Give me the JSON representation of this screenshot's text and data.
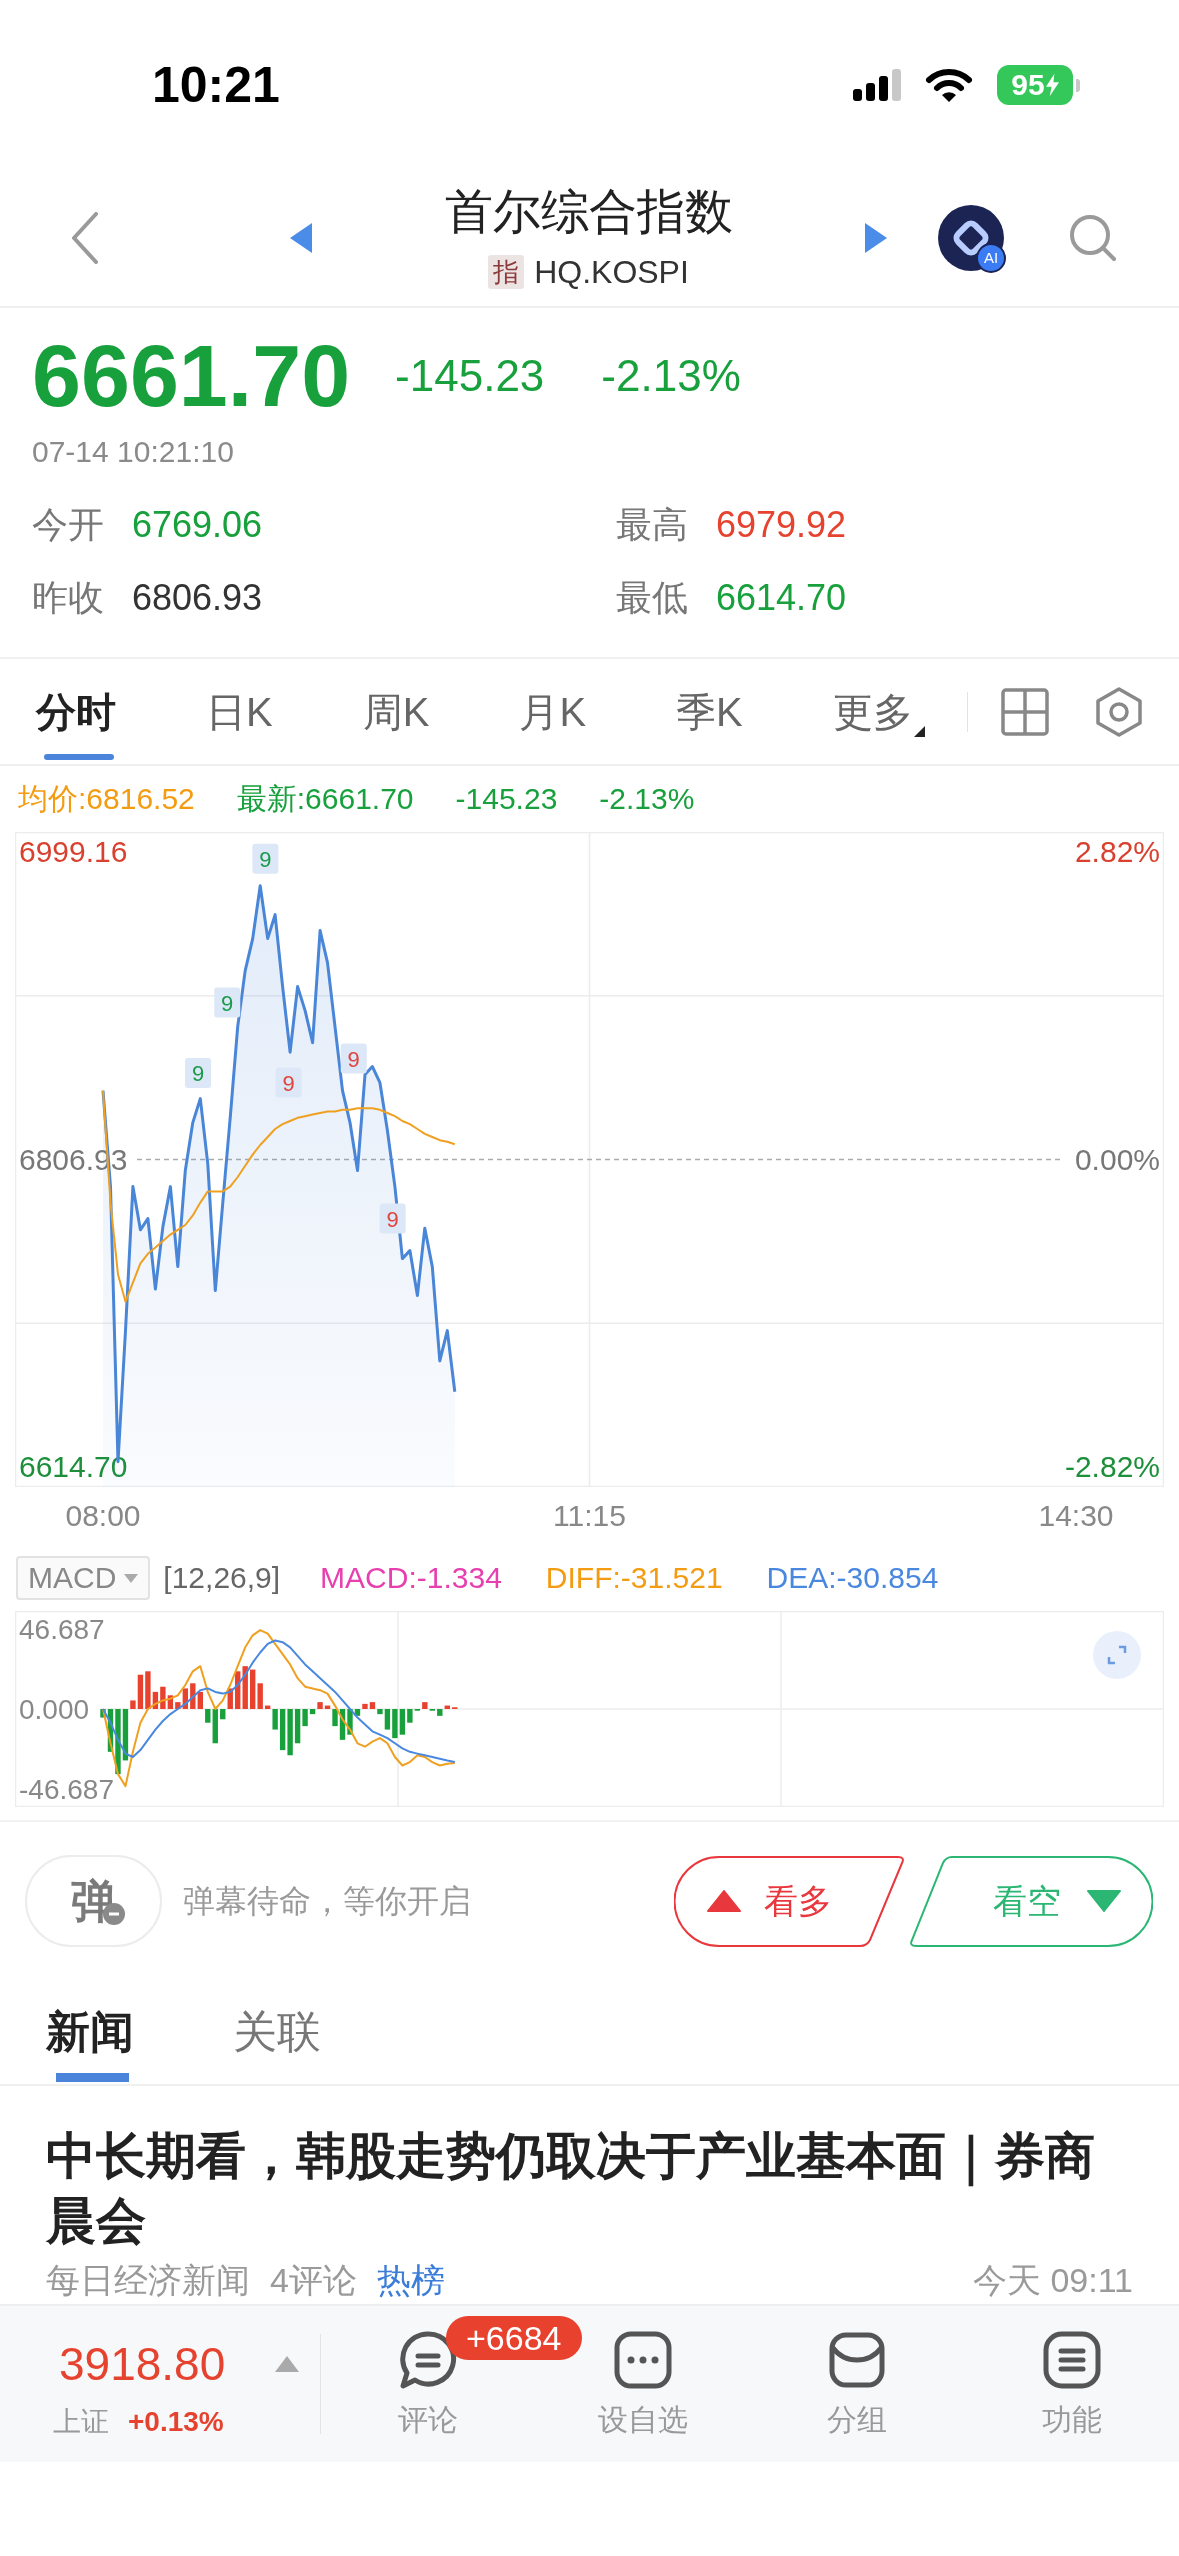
{
  "status_bar": {
    "time": "10:21",
    "battery": "95"
  },
  "header": {
    "title": "首尔综合指数",
    "type_badge": "指",
    "code": "HQ.KOSPI",
    "ai_badge": "AI"
  },
  "quote": {
    "price": "6661.70",
    "change": "-145.23",
    "change_pct": "-2.13%",
    "rising": false,
    "timestamp": "07-14 10:21:10",
    "stats": [
      {
        "label": "今开",
        "value": "6769.06",
        "color": "#17a03c"
      },
      {
        "label": "最高",
        "value": "6979.92",
        "color": "#e5432f"
      },
      {
        "label": "昨收",
        "value": "6806.93",
        "color": "#333333"
      },
      {
        "label": "最低",
        "value": "6614.70",
        "color": "#17a03c"
      }
    ]
  },
  "chart_tabs": [
    {
      "label": "分时",
      "selected": true,
      "dropdown": false
    },
    {
      "label": "日K",
      "selected": false,
      "dropdown": false
    },
    {
      "label": "周K",
      "selected": false,
      "dropdown": false
    },
    {
      "label": "月K",
      "selected": false,
      "dropdown": false
    },
    {
      "label": "季K",
      "selected": false,
      "dropdown": false
    },
    {
      "label": "更多",
      "selected": false,
      "dropdown": true
    }
  ],
  "price_chart": {
    "legend": [
      {
        "text": "均价:6816.52",
        "color": "#f39c12"
      },
      {
        "text": "最新:6661.70",
        "color": "#17a03c"
      },
      {
        "text": "-145.23",
        "color": "#17a03c"
      },
      {
        "text": "-2.13%",
        "color": "#17a03c"
      }
    ],
    "percent_labels": [
      "2.82%",
      "0.00%",
      "-2.82%"
    ],
    "signals": [
      {
        "text": "9",
        "color": "#1a9a4a"
      },
      {
        "text": "9",
        "color": "#1a9a4a"
      },
      {
        "text": "9",
        "color": "#1a9a4a"
      },
      {
        "text": "9",
        "color": "#e0443a"
      },
      {
        "text": "9",
        "color": "#e0443a"
      },
      {
        "text": "9",
        "color": "#e0443a"
      }
    ],
    "chart_data": {
      "type": "line",
      "categories": [
        "08:00",
        null,
        null,
        null,
        null,
        null,
        null,
        null,
        null,
        null,
        null,
        null,
        null,
        null,
        null,
        null,
        null,
        null,
        null,
        null,
        null,
        null,
        null,
        null,
        null,
        null,
        null,
        null,
        null,
        null,
        null,
        null,
        null,
        null,
        null,
        null,
        null,
        null,
        null,
        null,
        null,
        null,
        null,
        null,
        null,
        null,
        null,
        null,
        null,
        null,
        null,
        null,
        null,
        null,
        null,
        null,
        null,
        null,
        null,
        null,
        null,
        null,
        null,
        null,
        null,
        "11:15",
        null,
        null,
        null,
        null,
        null,
        null,
        null,
        null,
        null,
        null,
        null,
        null,
        null,
        null,
        null,
        null,
        null,
        null,
        null,
        null,
        null,
        null,
        null,
        null,
        null,
        null,
        null,
        null,
        null,
        null,
        null,
        null,
        null,
        null,
        null,
        null,
        null,
        null,
        null,
        null,
        null,
        null,
        null,
        null,
        null,
        null,
        null,
        null,
        null,
        null,
        null,
        null,
        null,
        null,
        null,
        null,
        null,
        null,
        null,
        null,
        null,
        null,
        null,
        null,
        "14:30"
      ],
      "ylim": [
        6614.7,
        6999.16
      ],
      "yticks": [
        {
          "value": 6999.16,
          "label": "6999.16"
        },
        {
          "value": 6806.93,
          "label": "6806.93"
        },
        {
          "value": 6614.7,
          "label": "6614.70"
        }
      ],
      "ref_lines": [
        {
          "axis": "y",
          "value": 6806.93
        }
      ],
      "series": [
        {
          "color": "#4a86d8",
          "values": [
            6850,
            6790,
            6618,
            6700,
            6790,
            6763,
            6770,
            6726,
            6765,
            6790,
            6740,
            6800,
            6830,
            6845,
            6804,
            6725,
            6780,
            6833,
            6890,
            6925,
            6945,
            6978,
            6945,
            6960,
            6915,
            6874,
            6915,
            6900,
            6880,
            6950,
            6930,
            6890,
            6850,
            6830,
            6800,
            6860,
            6865,
            6855,
            6825,
            6790,
            6745,
            6750,
            6722,
            6764,
            6740,
            6681,
            6700,
            6661.7,
            null,
            null,
            null,
            null,
            null,
            null,
            null,
            null,
            null,
            null,
            null,
            null,
            null,
            null,
            null,
            null,
            null,
            null,
            null,
            null,
            null,
            null,
            null,
            null,
            null,
            null,
            null,
            null,
            null,
            null,
            null,
            null,
            null,
            null,
            null,
            null,
            null,
            null,
            null,
            null,
            null,
            null,
            null,
            null,
            null,
            null,
            null,
            null,
            null,
            null,
            null,
            null,
            null,
            null,
            null,
            null,
            null,
            null,
            null,
            null,
            null,
            null,
            null,
            null,
            null,
            null,
            null,
            null,
            null,
            null,
            null,
            null,
            null,
            null,
            null,
            null,
            null,
            null,
            null,
            null,
            null,
            null,
            null
          ]
        },
        {
          "color": "#f0a020",
          "values": [
            6850,
            6780,
            6735,
            6718,
            6730,
            6742,
            6748,
            6752,
            6756,
            6760,
            6763,
            6766,
            6772,
            6780,
            6787,
            6787,
            6787,
            6790,
            6796,
            6803,
            6810,
            6816,
            6821,
            6826,
            6829,
            6831,
            6833,
            6834,
            6835,
            6836,
            6837,
            6837,
            6838,
            6838,
            6839,
            6839,
            6839,
            6838,
            6836,
            6834,
            6831,
            6829,
            6826,
            6823,
            6821,
            6819,
            6818,
            6816.5,
            null,
            null,
            null,
            null,
            null,
            null,
            null,
            null,
            null,
            null,
            null,
            null,
            null,
            null,
            null,
            null,
            null,
            null,
            null,
            null,
            null,
            null,
            null,
            null,
            null,
            null,
            null,
            null,
            null,
            null,
            null,
            null,
            null,
            null,
            null,
            null,
            null,
            null,
            null,
            null,
            null,
            null,
            null,
            null,
            null,
            null,
            null,
            null,
            null,
            null,
            null,
            null,
            null,
            null,
            null,
            null,
            null,
            null,
            null,
            null,
            null,
            null,
            null,
            null,
            null,
            null,
            null,
            null,
            null,
            null,
            null,
            null,
            null,
            null,
            null,
            null,
            null,
            null,
            null,
            null,
            null,
            null,
            null
          ]
        }
      ]
    }
  },
  "macd": {
    "indicator": "MACD",
    "params": "[12,26,9]",
    "values": [
      {
        "text": "MACD:-1.334",
        "color": "#e83fb0"
      },
      {
        "text": "DIFF:-31.521",
        "color": "#f39c12"
      },
      {
        "text": "DEA:-30.854",
        "color": "#4a88e0"
      }
    ],
    "chart_data": {
      "type": "bar",
      "categories": [
        null,
        null,
        null,
        null,
        null,
        null,
        null,
        null,
        null,
        null,
        null,
        null,
        null,
        null,
        null,
        null,
        null,
        null,
        null,
        null,
        null,
        null,
        null,
        null,
        null,
        null,
        null,
        null,
        null,
        null,
        null,
        null,
        null,
        null,
        null,
        null,
        null,
        null,
        null,
        null,
        null,
        null,
        null,
        null,
        null,
        null,
        null,
        null,
        null,
        null,
        null,
        null,
        null,
        null,
        null,
        null,
        null,
        null,
        null,
        null,
        null,
        null,
        null,
        null,
        null,
        null,
        null,
        null,
        null,
        null,
        null,
        null,
        null,
        null,
        null,
        null,
        null,
        null,
        null,
        null,
        null,
        null,
        null,
        null,
        null,
        null,
        null,
        null,
        null,
        null,
        null,
        null,
        null,
        null,
        null,
        null,
        null,
        null,
        null,
        null,
        null,
        null,
        null,
        null,
        null,
        null,
        null,
        null,
        null,
        null,
        null,
        null,
        null,
        null,
        null,
        null,
        null,
        null,
        null,
        null,
        null,
        null,
        null,
        null,
        null,
        null,
        null,
        null,
        null,
        null,
        null
      ],
      "ylim": [
        -46.687,
        46.687
      ],
      "yticks": [
        {
          "value": 46.687,
          "label": "46.687"
        },
        {
          "value": 0,
          "label": "0.000"
        },
        {
          "value": -46.687,
          "label": "-46.687"
        }
      ],
      "series": [
        {
          "values": [
            -5,
            -25,
            -38,
            -30,
            5,
            20,
            22,
            10,
            13,
            8,
            4,
            12,
            15,
            10,
            -8,
            -20,
            -6,
            12,
            22,
            25,
            23,
            15,
            2,
            -12,
            -24,
            -27,
            -20,
            -10,
            -3,
            4,
            2,
            -10,
            -18,
            -15,
            -4,
            3,
            4,
            -3,
            -12,
            -17,
            -15,
            -8,
            -1,
            4,
            -1,
            -4,
            2,
            1,
            null,
            null,
            null,
            null,
            null,
            null,
            null,
            null,
            null,
            null,
            null,
            null,
            null,
            null,
            null,
            null,
            null,
            null,
            null,
            null,
            null,
            null,
            null,
            null,
            null,
            null,
            null,
            null,
            null,
            null,
            null,
            null,
            null,
            null,
            null,
            null,
            null,
            null,
            null,
            null,
            null,
            null,
            null,
            null,
            null,
            null,
            null,
            null,
            null,
            null,
            null,
            null,
            null,
            null,
            null,
            null,
            null,
            null,
            null,
            null,
            null,
            null,
            null,
            null,
            null,
            null,
            null,
            null,
            null,
            null,
            null,
            null,
            null,
            null,
            null,
            null,
            null,
            null,
            null,
            null,
            null,
            null,
            null
          ]
        }
      ]
    },
    "lines": {
      "chart_data": {
        "type": "line",
        "categories": [
          null,
          null,
          null,
          null,
          null,
          null,
          null,
          null,
          null,
          null,
          null,
          null,
          null,
          null,
          null,
          null,
          null,
          null,
          null,
          null,
          null,
          null,
          null,
          null,
          null,
          null,
          null,
          null,
          null,
          null,
          null,
          null,
          null,
          null,
          null,
          null,
          null,
          null,
          null,
          null,
          null,
          null,
          null,
          null,
          null,
          null,
          null,
          null,
          null,
          null,
          null,
          null,
          null,
          null,
          null,
          null,
          null,
          null,
          null,
          null,
          null,
          null,
          null,
          null,
          null,
          null,
          null,
          null,
          null,
          null,
          null,
          null,
          null,
          null,
          null,
          null,
          null,
          null,
          null,
          null,
          null,
          null,
          null,
          null,
          null,
          null,
          null,
          null,
          null,
          null,
          null,
          null,
          null,
          null,
          null,
          null,
          null,
          null,
          null,
          null,
          null,
          null,
          null,
          null,
          null,
          null,
          null,
          null,
          null,
          null,
          null,
          null,
          null,
          null,
          null,
          null,
          null,
          null,
          null,
          null,
          null,
          null,
          null,
          null,
          null,
          null,
          null,
          null,
          null,
          null,
          null
        ],
        "ylim": [
          -46.687,
          46.687
        ],
        "series": [
          {
            "color": "#f0a020",
            "values": [
              0,
              -20,
              -38,
              -45,
              -25,
              -8,
              0,
              3,
              5,
              6,
              8,
              14,
              22,
              25,
              10,
              0,
              5,
              14,
              25,
              36,
              43,
              46,
              44,
              38,
              32,
              26,
              18,
              13,
              12,
              11,
              9,
              2,
              -6,
              -12,
              -20,
              -22,
              -19,
              -17,
              -20,
              -28,
              -33,
              -31,
              -27,
              -28,
              -31,
              -33,
              -32,
              -31.5,
              null,
              null,
              null,
              null,
              null,
              null,
              null,
              null,
              null,
              null,
              null,
              null,
              null,
              null,
              null,
              null,
              null,
              null,
              null,
              null,
              null,
              null,
              null,
              null,
              null,
              null,
              null,
              null,
              null,
              null,
              null,
              null,
              null,
              null,
              null,
              null,
              null,
              null,
              null,
              null,
              null,
              null,
              null,
              null,
              null,
              null,
              null,
              null,
              null,
              null,
              null,
              null,
              null,
              null,
              null,
              null,
              null,
              null,
              null,
              null,
              null,
              null,
              null,
              null,
              null,
              null,
              null,
              null,
              null,
              null,
              null,
              null,
              null,
              null,
              null,
              null,
              null,
              null,
              null,
              null,
              null,
              null,
              null
            ]
          },
          {
            "color": "#4a88e0",
            "values": [
              0,
              -8,
              -18,
              -26,
              -28,
              -24,
              -18,
              -12,
              -7,
              -3,
              0,
              3,
              7,
              11,
              12,
              10,
              9,
              10,
              14,
              20,
              27,
              33,
              38,
              40,
              39,
              36,
              31,
              26,
              22,
              18,
              14,
              10,
              5,
              0,
              -5,
              -9,
              -13,
              -15,
              -17,
              -20,
              -23,
              -25,
              -26,
              -27,
              -28,
              -29,
              -30,
              -30.9,
              null,
              null,
              null,
              null,
              null,
              null,
              null,
              null,
              null,
              null,
              null,
              null,
              null,
              null,
              null,
              null,
              null,
              null,
              null,
              null,
              null,
              null,
              null,
              null,
              null,
              null,
              null,
              null,
              null,
              null,
              null,
              null,
              null,
              null,
              null,
              null,
              null,
              null,
              null,
              null,
              null,
              null,
              null,
              null,
              null,
              null,
              null,
              null,
              null,
              null,
              null,
              null,
              null,
              null,
              null,
              null,
              null,
              null,
              null,
              null,
              null,
              null,
              null,
              null,
              null,
              null,
              null,
              null,
              null,
              null,
              null,
              null,
              null,
              null,
              null,
              null,
              null,
              null,
              null,
              null,
              null,
              null,
              null
            ]
          }
        ]
      }
    }
  },
  "danmaku": {
    "toggle": "弹",
    "hint": "弹幕待命，等你开启"
  },
  "sentiment": [
    {
      "label": "看多",
      "kind": "bull"
    },
    {
      "label": "看空",
      "kind": "bear"
    }
  ],
  "news_tabs": [
    {
      "label": "新闻",
      "selected": true
    },
    {
      "label": "关联",
      "selected": false
    }
  ],
  "news": [
    {
      "title": "中长期看，韩股走势仍取决于产业基本面｜券商晨会",
      "source": "每日经济新闻",
      "comments": "4评论",
      "tag": "热榜",
      "time": "今天 09:11"
    }
  ],
  "bottom_bar": {
    "market": {
      "price": "3918.80",
      "name": "上证",
      "change_pct": "+0.13%",
      "rising": true
    },
    "actions": [
      {
        "label": "评论",
        "kind": "comment",
        "badge": "+6684"
      },
      {
        "label": "设自选",
        "kind": "watchlist"
      },
      {
        "label": "分组",
        "kind": "group"
      },
      {
        "label": "功能",
        "kind": "menu"
      }
    ]
  }
}
